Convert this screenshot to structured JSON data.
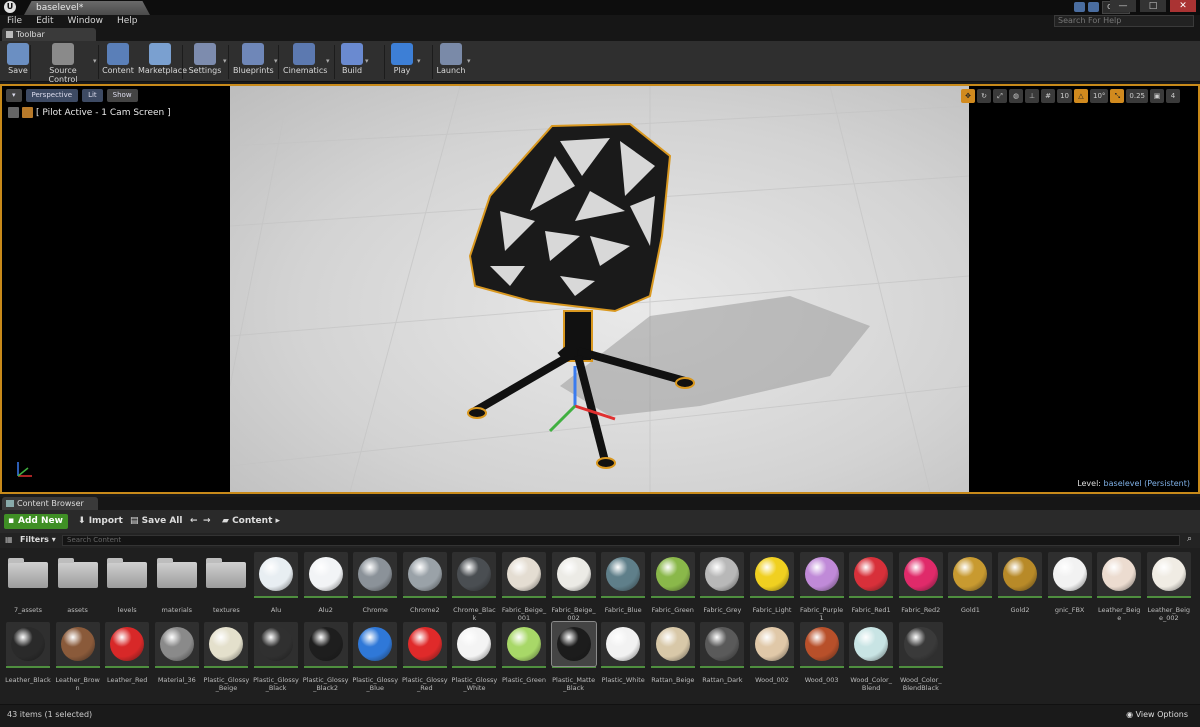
{
  "window": {
    "tab_title": "baselevel*",
    "user": "cgw",
    "help_placeholder": "Search For Help",
    "min": "—",
    "max": "□",
    "close": "✕"
  },
  "menu": [
    "File",
    "Edit",
    "Window",
    "Help"
  ],
  "toolbar": {
    "tab_label": "Toolbar",
    "buttons": [
      {
        "label": "Save",
        "icon": "save-icon",
        "color": "#6b8fc2"
      },
      {
        "label": "Source Control",
        "icon": "source-control-icon",
        "color": "#8a8a8a"
      },
      {
        "label": "Content",
        "icon": "content-icon",
        "color": "#5a7fb8"
      },
      {
        "label": "Marketplace",
        "icon": "marketplace-icon",
        "color": "#7aa0d0"
      },
      {
        "label": "Settings",
        "icon": "settings-icon",
        "color": "#7d8cae"
      },
      {
        "label": "Blueprints",
        "icon": "blueprints-icon",
        "color": "#6f87b8"
      },
      {
        "label": "Cinematics",
        "icon": "cinematics-icon",
        "color": "#5c79b0"
      },
      {
        "label": "Build",
        "icon": "build-icon",
        "color": "#6a8ad0"
      },
      {
        "label": "Play",
        "icon": "play-icon",
        "color": "#3d7fd6"
      },
      {
        "label": "Launch",
        "icon": "launch-icon",
        "color": "#7a8aa8"
      }
    ]
  },
  "viewport": {
    "perspective": "Perspective",
    "lit": "Lit",
    "show": "Show",
    "pilot_label": "[ Pilot Active - 1 Cam Screen ]",
    "grid_snap": "10",
    "rot_snap": "10°",
    "scale_snap": "0.25",
    "cam_speed": "4",
    "level_label": "Level:",
    "level_name": "baselevel (Persistent)",
    "accent": "#c88a1a"
  },
  "content_browser": {
    "tab_label": "Content Browser",
    "add_new": "Add New",
    "import": "Import",
    "save_all": "Save All",
    "path": "Content",
    "filters": "Filters",
    "search_placeholder": "Search Content",
    "item_count": "43 items (1 selected)",
    "view_options": "View Options",
    "folders": [
      "7_assets",
      "assets",
      "levels",
      "materials",
      "textures"
    ],
    "row1": [
      {
        "name": "Alu",
        "color": "#e8eef2"
      },
      {
        "name": "Alu2",
        "color": "#f2f4f6"
      },
      {
        "name": "Chrome",
        "color": "#8b9299"
      },
      {
        "name": "Chrome2",
        "color": "#9aa2a8"
      },
      {
        "name": "Chrome_Black",
        "color": "#4a4e52"
      },
      {
        "name": "Fabric_Beige_001",
        "color": "#e4ddd2"
      },
      {
        "name": "Fabric_Beige_002",
        "color": "#ecebe6"
      },
      {
        "name": "Fabric_Blue",
        "color": "#5f7f8a"
      },
      {
        "name": "Fabric_Green",
        "color": "#8ab84a"
      },
      {
        "name": "Fabric_Grey",
        "color": "#b8b8b8"
      },
      {
        "name": "Fabric_Light",
        "color": "#f0d020"
      },
      {
        "name": "Fabric_Purple1",
        "color": "#c08ad8"
      },
      {
        "name": "Fabric_Red1",
        "color": "#d8303a"
      },
      {
        "name": "Fabric_Red2",
        "color": "#e02a6a"
      },
      {
        "name": "Gold1",
        "color": "#c89a30"
      },
      {
        "name": "Gold2",
        "color": "#b88a28"
      },
      {
        "name": "gnic_FBX",
        "color": "#f2f2f2"
      },
      {
        "name": "Leather_Beige",
        "color": "#ecdcd0"
      },
      {
        "name": "Leather_Beige_002",
        "color": "#f0ece4"
      }
    ],
    "row2": [
      {
        "name": "Leather_Black",
        "color": "#2a2a2a"
      },
      {
        "name": "Leather_Brown",
        "color": "#8a5a3a"
      },
      {
        "name": "Leather_Red",
        "color": "#d82828"
      },
      {
        "name": "Material_36",
        "color": "#8a8a8a"
      },
      {
        "name": "Plastic_Glossy_Beige",
        "color": "#e4e0cc"
      },
      {
        "name": "Plastic_Glossy_Black",
        "color": "#303030"
      },
      {
        "name": "Plastic_Glossy_Black2",
        "color": "#1e1e1e"
      },
      {
        "name": "Plastic_Glossy_Blue",
        "color": "#2f78d8"
      },
      {
        "name": "Plastic_Glossy_Red",
        "color": "#e02a2a"
      },
      {
        "name": "Plastic_Glossy_White",
        "color": "#f4f4f4"
      },
      {
        "name": "Plastic_Green",
        "color": "#a8d868"
      },
      {
        "name": "Plastic_Matte_Black",
        "color": "#1c1c1c"
      },
      {
        "name": "Plastic_White",
        "color": "#f2f2f2"
      },
      {
        "name": "Rattan_Beige",
        "color": "#d8c8a8"
      },
      {
        "name": "Rattan_Dark",
        "color": "#5a5a5a"
      },
      {
        "name": "Wood_002",
        "color": "#e0c8a8"
      },
      {
        "name": "Wood_003",
        "color": "#b8502a"
      },
      {
        "name": "Wood_Color_Blend",
        "color": "#c8e4e4"
      },
      {
        "name": "Wood_Color_BlendBlack",
        "color": "#3a3a3a"
      }
    ]
  }
}
